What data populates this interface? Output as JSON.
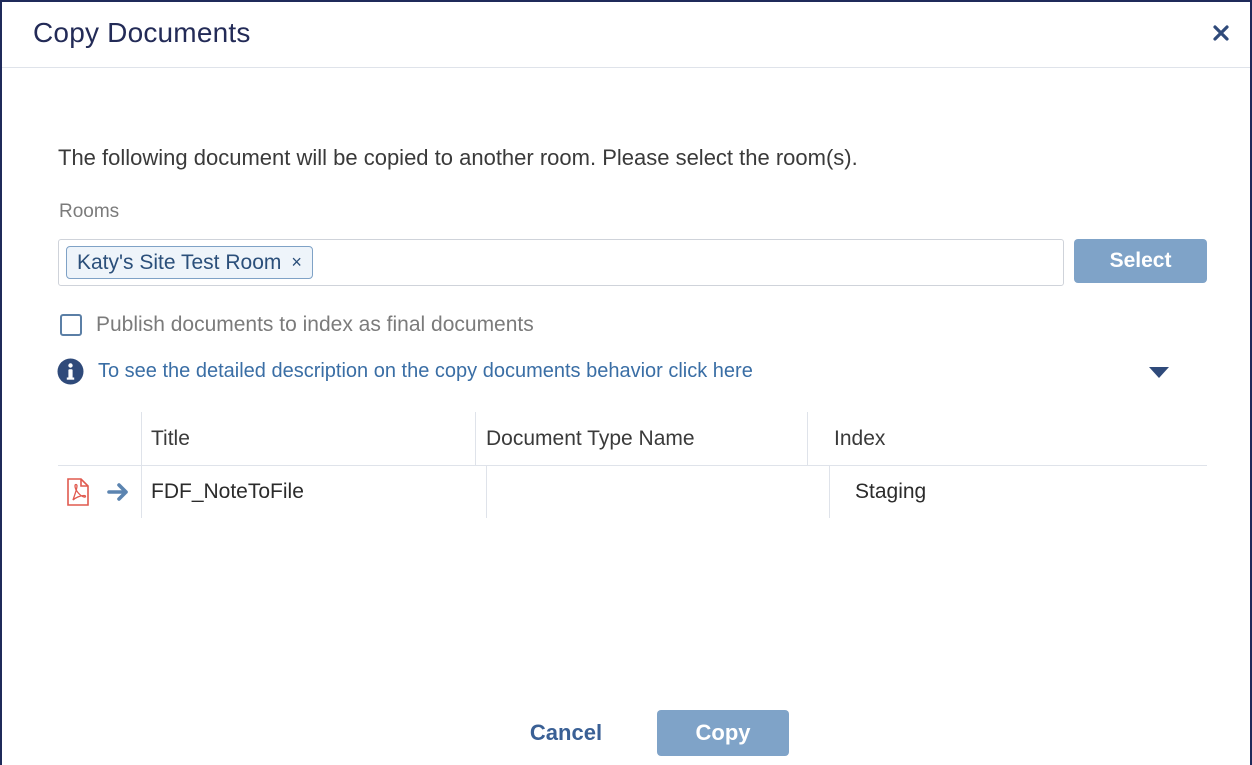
{
  "dialog": {
    "title": "Copy Documents",
    "intro": "The following document will be copied to another room. Please select the room(s).",
    "rooms_label": "Rooms",
    "selected_rooms": [
      {
        "label": "Katy's Site Test Room",
        "remove_glyph": "×"
      }
    ],
    "select_button": "Select",
    "publish_checkbox": {
      "label": "Publish documents to index as final documents",
      "checked": false
    },
    "info_link": "To see the detailed description on the copy documents behavior click here"
  },
  "table": {
    "headers": [
      "Title",
      "Document Type Name",
      "Index"
    ],
    "rows": [
      {
        "icon": "pdf-file-icon",
        "action_icon": "arrow-right-icon",
        "title": "FDF_NoteToFile",
        "document_type_name": "",
        "index": "Staging"
      }
    ]
  },
  "footer": {
    "cancel_button": "Cancel",
    "copy_button": "Copy"
  },
  "colors": {
    "title": "#232b57",
    "accent": "#7fa3c8",
    "link": "#3a6ea5",
    "pdf_icon": "#e05a4f"
  }
}
